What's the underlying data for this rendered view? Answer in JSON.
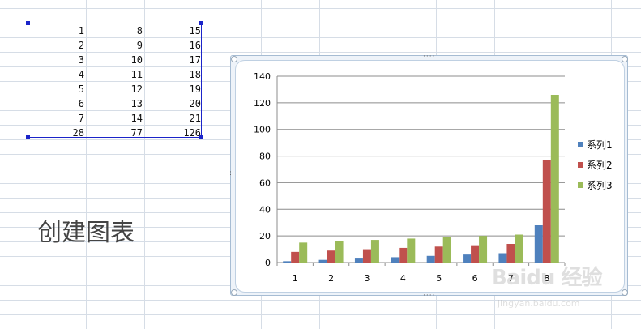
{
  "sheet": {
    "rows": [
      [
        "1",
        "8",
        "15"
      ],
      [
        "2",
        "9",
        "16"
      ],
      [
        "3",
        "10",
        "17"
      ],
      [
        "4",
        "11",
        "18"
      ],
      [
        "5",
        "12",
        "19"
      ],
      [
        "6",
        "13",
        "20"
      ],
      [
        "7",
        "14",
        "21"
      ],
      [
        "28",
        "77",
        "126"
      ]
    ]
  },
  "caption": "创建图表",
  "watermark": {
    "brand": "Baidu 经验",
    "url": "jingyan.baidu.com"
  },
  "colors": {
    "series1": "#4f81bd",
    "series2": "#c0504d",
    "series3": "#9bbb59",
    "selection": "#1b24c9"
  },
  "chart_data": {
    "type": "bar",
    "categories": [
      "1",
      "2",
      "3",
      "4",
      "5",
      "6",
      "7",
      "8"
    ],
    "series": [
      {
        "name": "系列1",
        "values": [
          1,
          2,
          3,
          4,
          5,
          6,
          7,
          28
        ]
      },
      {
        "name": "系列2",
        "values": [
          8,
          9,
          10,
          11,
          12,
          13,
          14,
          77
        ]
      },
      {
        "name": "系列3",
        "values": [
          15,
          16,
          17,
          18,
          19,
          20,
          21,
          126
        ]
      }
    ],
    "yticks": [
      "0",
      "20",
      "40",
      "60",
      "80",
      "100",
      "120",
      "140"
    ],
    "ylim": [
      0,
      140
    ],
    "grid": true,
    "legend": "right"
  }
}
